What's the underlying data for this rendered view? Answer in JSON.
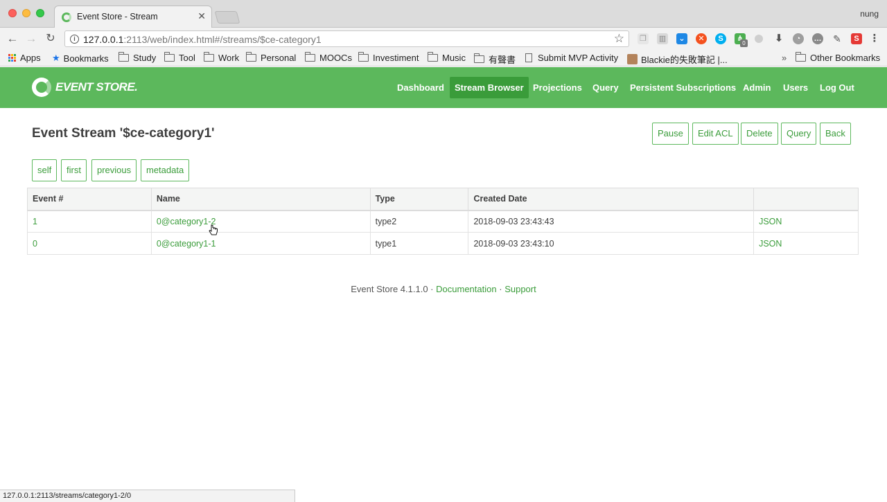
{
  "browser": {
    "tab_title": "Event Store - Stream",
    "tab_close": "✕",
    "user": "nung",
    "url_host": "127.0.0.1",
    "url_rest": ":2113/web/index.html#/streams/$ce-category1",
    "bookmarks": [
      {
        "label": "Apps",
        "icon": "apps-grid-icon"
      },
      {
        "label": "Bookmarks",
        "icon": "star-icon"
      },
      {
        "label": "Study",
        "icon": "folder-icon"
      },
      {
        "label": "Tool",
        "icon": "folder-icon"
      },
      {
        "label": "Work",
        "icon": "folder-icon"
      },
      {
        "label": "Personal",
        "icon": "folder-icon"
      },
      {
        "label": "MOOCs",
        "icon": "folder-icon"
      },
      {
        "label": "Investiment",
        "icon": "folder-icon"
      },
      {
        "label": "Music",
        "icon": "folder-icon"
      },
      {
        "label": "有聲書",
        "icon": "folder-icon"
      },
      {
        "label": "Submit MVP Activity",
        "icon": "document-icon"
      },
      {
        "label": "Blackie的失敗筆記 |...",
        "icon": "avatar-icon"
      }
    ],
    "overflow": "»",
    "other_bookmarks": "Other Bookmarks",
    "extension_badge": "0",
    "status_url": "127.0.0.1:2113/streams/category1-2/0"
  },
  "app": {
    "logo_text": "EVENT STORE.",
    "nav": [
      "Dashboard",
      "Stream Browser",
      "Projections",
      "Query",
      "Persistent Subscriptions",
      "Admin",
      "Users",
      "Log Out"
    ],
    "active_nav": "Stream Browser",
    "page_title": "Event Stream '$ce-category1'",
    "actions": [
      "Pause",
      "Edit ACL",
      "Delete",
      "Query",
      "Back"
    ],
    "pager": [
      "self",
      "first",
      "previous",
      "metadata"
    ],
    "table": {
      "headers": [
        "Event #",
        "Name",
        "Type",
        "Created Date",
        ""
      ],
      "rows": [
        {
          "number": "1",
          "name": "0@category1-2",
          "type": "type2",
          "created": "2018-09-03 23:43:43",
          "format": "JSON"
        },
        {
          "number": "0",
          "name": "0@category1-1",
          "type": "type1",
          "created": "2018-09-03 23:43:10",
          "format": "JSON"
        }
      ]
    },
    "footer": {
      "version": "Event Store 4.1.1.0",
      "sep": "·",
      "documentation": "Documentation",
      "support": "Support"
    }
  },
  "colors": {
    "brand_green": "#5cb85c",
    "active_green": "#3a9c3a"
  }
}
